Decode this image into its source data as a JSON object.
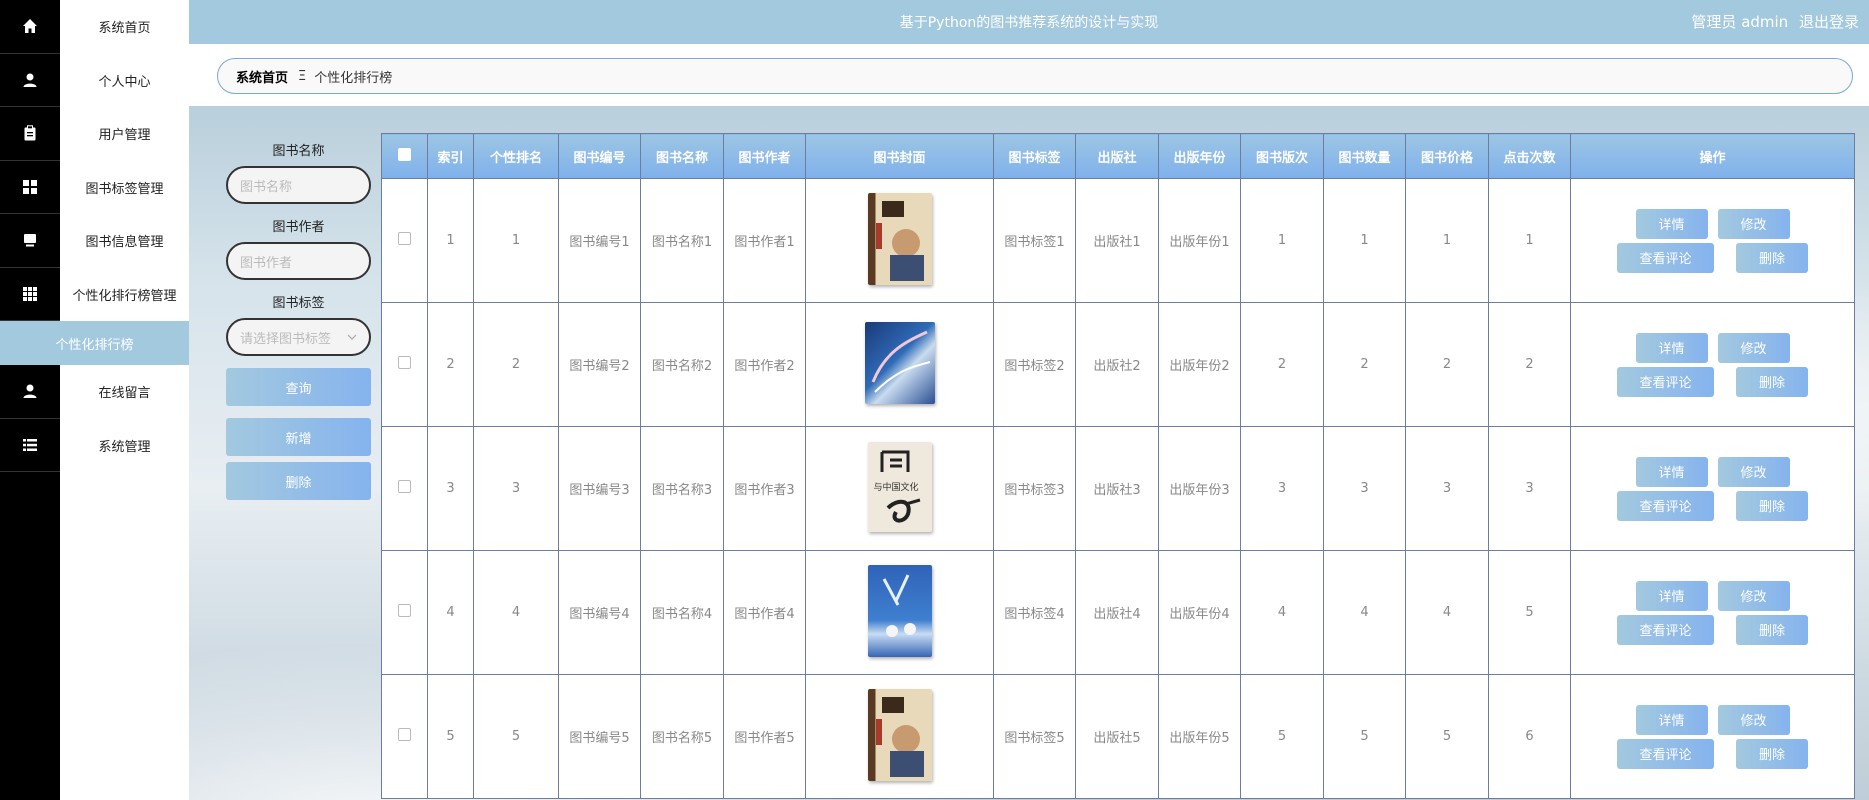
{
  "header": {
    "title": "基于Python的图书推荐系统的设计与实现",
    "user_role": "管理员 admin",
    "logout": "退出登录"
  },
  "menu": [
    {
      "label": "系统首页",
      "icon": "home-icon"
    },
    {
      "label": "个人中心",
      "icon": "user-icon"
    },
    {
      "label": "用户管理",
      "icon": "clipboard-icon"
    },
    {
      "label": "图书标签管理",
      "icon": "grid-icon"
    },
    {
      "label": "图书信息管理",
      "icon": "monitor-icon"
    },
    {
      "label": "个性化排行榜管理",
      "icon": "apps-icon"
    },
    {
      "label": "个性化排行榜",
      "icon": ""
    },
    {
      "label": "在线留言",
      "icon": "user-icon"
    },
    {
      "label": "系统管理",
      "icon": "list-icon"
    }
  ],
  "breadcrumb": {
    "home": "系统首页",
    "separator": "Ξ",
    "current": "个性化排行榜"
  },
  "search": {
    "name_label": "图书名称",
    "name_placeholder": "图书名称",
    "author_label": "图书作者",
    "author_placeholder": "图书作者",
    "tag_label": "图书标签",
    "tag_placeholder": "请选择图书标签",
    "query_button": "查询",
    "add_button": "新增",
    "delete_button": "删除"
  },
  "table": {
    "columns": [
      "索引",
      "个性排名",
      "图书编号",
      "图书名称",
      "图书作者",
      "图书封面",
      "图书标签",
      "出版社",
      "出版年份",
      "图书版次",
      "图书数量",
      "图书价格",
      "点击次数",
      "操作"
    ],
    "rows": [
      {
        "index": "1",
        "rank": "1",
        "code": "图书编号1",
        "name": "图书名称1",
        "author": "图书作者1",
        "cover": "cover-1",
        "tag": "图书标签1",
        "press": "出版社1",
        "year": "出版年份1",
        "edition": "1",
        "count": "1",
        "price": "1",
        "clicks": "1"
      },
      {
        "index": "2",
        "rank": "2",
        "code": "图书编号2",
        "name": "图书名称2",
        "author": "图书作者2",
        "cover": "cover-2",
        "tag": "图书标签2",
        "press": "出版社2",
        "year": "出版年份2",
        "edition": "2",
        "count": "2",
        "price": "2",
        "clicks": "2"
      },
      {
        "index": "3",
        "rank": "3",
        "code": "图书编号3",
        "name": "图书名称3",
        "author": "图书作者3",
        "cover": "cover-3",
        "tag": "图书标签3",
        "press": "出版社3",
        "year": "出版年份3",
        "edition": "3",
        "count": "3",
        "price": "3",
        "clicks": "3"
      },
      {
        "index": "4",
        "rank": "4",
        "code": "图书编号4",
        "name": "图书名称4",
        "author": "图书作者4",
        "cover": "cover-4",
        "tag": "图书标签4",
        "press": "出版社4",
        "year": "出版年份4",
        "edition": "4",
        "count": "4",
        "price": "4",
        "clicks": "5"
      },
      {
        "index": "5",
        "rank": "5",
        "code": "图书编号5",
        "name": "图书名称5",
        "author": "图书作者5",
        "cover": "cover-5",
        "tag": "图书标签5",
        "press": "出版社5",
        "year": "出版年份5",
        "edition": "5",
        "count": "5",
        "price": "5",
        "clicks": "6"
      }
    ],
    "cover3_text": "与中国文化",
    "actions": {
      "detail": "详情",
      "edit": "修改",
      "comments": "查看评论",
      "delete": "删除"
    }
  },
  "colors": {
    "accent": "#a3c9df",
    "button_end": "#85b3ee",
    "sidebar_bg": "#000000"
  }
}
